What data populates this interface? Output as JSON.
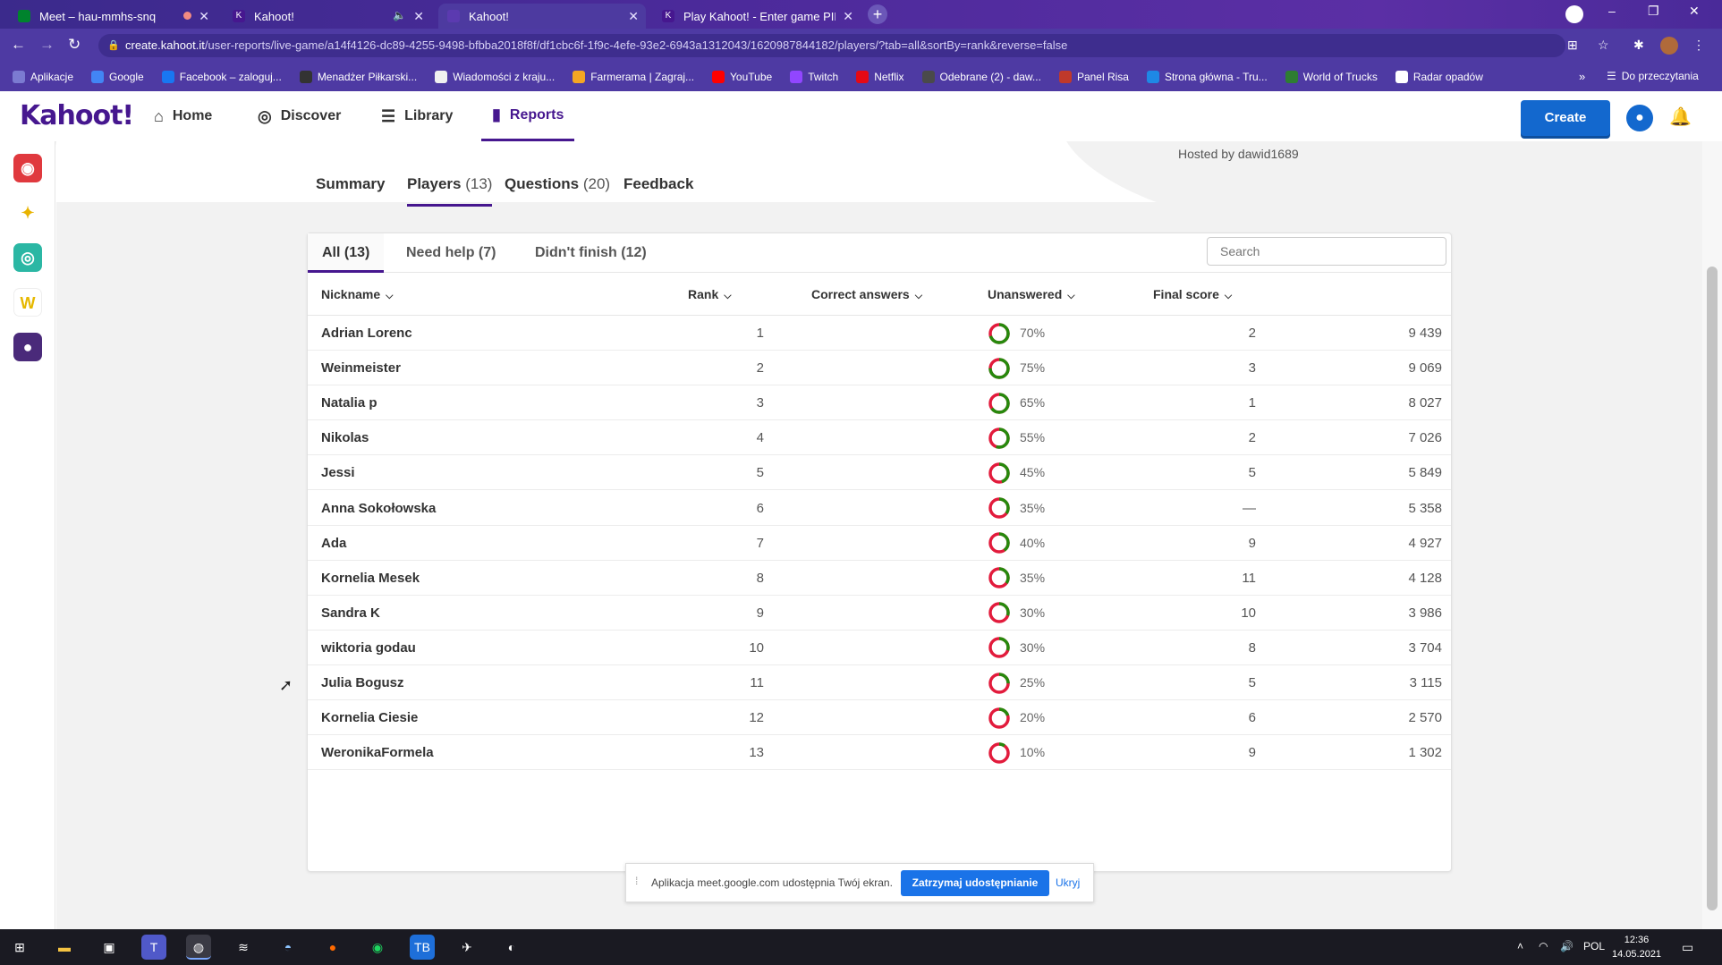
{
  "browser": {
    "tabs": [
      {
        "title": "Meet – hau-mmhs-snq",
        "active": false
      },
      {
        "title": "Kahoot!",
        "active": false
      },
      {
        "title": "Kahoot!",
        "active": true
      },
      {
        "title": "Play Kahoot! - Enter game PIN h",
        "active": false
      }
    ],
    "url_host": "create.kahoot.it",
    "url_path": "/user-reports/live-game/a14f4126-dc89-4255-9498-bfbba2018f8f/df1cbc6f-1f9c-4efe-93e2-6943a1312043/1620987844182/players/?tab=all&sortBy=rank&reverse=false",
    "bookmarks": [
      "Aplikacje",
      "Google",
      "Facebook – zaloguj...",
      "Menadżer Piłkarski...",
      "Wiadomości z kraju...",
      "Farmerama | Zagraj...",
      "YouTube",
      "Twitch",
      "Netflix",
      "Odebrane (2) - daw...",
      "Panel Risa",
      "Strona główna - Tru...",
      "World of Trucks",
      "Radar opadów"
    ],
    "reading_list": "Do przeczytania"
  },
  "header": {
    "logo": "Kahoot!",
    "nav": [
      {
        "label": "Home",
        "icon": "home-icon"
      },
      {
        "label": "Discover",
        "icon": "compass-icon"
      },
      {
        "label": "Library",
        "icon": "list-icon"
      },
      {
        "label": "Reports",
        "icon": "bar-chart-icon",
        "active": true
      }
    ],
    "create_label": "Create"
  },
  "report": {
    "hosted_by": "Hosted by dawid1689",
    "tabs": [
      {
        "label": "Summary",
        "count": ""
      },
      {
        "label": "Players",
        "count": "(13)"
      },
      {
        "label": "Questions",
        "count": "(20)"
      },
      {
        "label": "Feedback",
        "count": ""
      }
    ],
    "subtabs": [
      "All (13)",
      "Need help (7)",
      "Didn't finish (12)"
    ],
    "search_placeholder": "Search",
    "columns": [
      "Nickname",
      "Rank",
      "Correct answers",
      "Unanswered",
      "Final score"
    ],
    "players": [
      {
        "nickname": "Adrian Lorenc",
        "rank": "1",
        "correct": "70%",
        "correct_value": 70,
        "unanswered": "2",
        "score": "9 439"
      },
      {
        "nickname": "Weinmeister",
        "rank": "2",
        "correct": "75%",
        "correct_value": 75,
        "unanswered": "3",
        "score": "9 069"
      },
      {
        "nickname": "Natalia p",
        "rank": "3",
        "correct": "65%",
        "correct_value": 65,
        "unanswered": "1",
        "score": "8 027"
      },
      {
        "nickname": "Nikolas",
        "rank": "4",
        "correct": "55%",
        "correct_value": 55,
        "unanswered": "2",
        "score": "7 026"
      },
      {
        "nickname": "Jessi",
        "rank": "5",
        "correct": "45%",
        "correct_value": 45,
        "unanswered": "5",
        "score": "5 849"
      },
      {
        "nickname": "Anna Sokołowska",
        "rank": "6",
        "correct": "35%",
        "correct_value": 35,
        "unanswered": "—",
        "score": "5 358"
      },
      {
        "nickname": "Ada",
        "rank": "7",
        "correct": "40%",
        "correct_value": 40,
        "unanswered": "9",
        "score": "4 927"
      },
      {
        "nickname": "Kornelia Mesek",
        "rank": "8",
        "correct": "35%",
        "correct_value": 35,
        "unanswered": "11",
        "score": "4 128"
      },
      {
        "nickname": "Sandra K",
        "rank": "9",
        "correct": "30%",
        "correct_value": 30,
        "unanswered": "10",
        "score": "3 986"
      },
      {
        "nickname": "wiktoria godau",
        "rank": "10",
        "correct": "30%",
        "correct_value": 30,
        "unanswered": "8",
        "score": "3 704"
      },
      {
        "nickname": "Julia Bogusz",
        "rank": "11",
        "correct": "25%",
        "correct_value": 25,
        "unanswered": "5",
        "score": "3 115"
      },
      {
        "nickname": "Kornelia Ciesie",
        "rank": "12",
        "correct": "20%",
        "correct_value": 20,
        "unanswered": "6",
        "score": "2 570"
      },
      {
        "nickname": "WeronikaFormela",
        "rank": "13",
        "correct": "10%",
        "correct_value": 10,
        "unanswered": "9",
        "score": "1 302"
      }
    ],
    "colors": {
      "correct": "#26890c",
      "incorrect": "#e21b3c",
      "accent": "#46178f"
    }
  },
  "share_banner": {
    "text": "Aplikacja meet.google.com udostępnia Twój ekran.",
    "stop_label": "Zatrzymaj udostępnianie",
    "hide_label": "Ukryj"
  },
  "taskbar": {
    "language": "POL",
    "time": "12:36",
    "date": "14.05.2021"
  }
}
